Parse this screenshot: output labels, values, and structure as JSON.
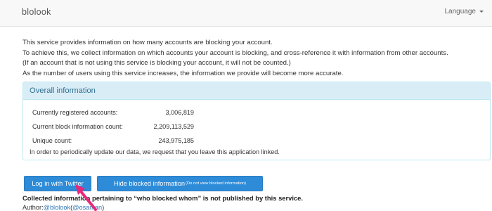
{
  "navbar": {
    "brand": "blolook",
    "language_label": "Language"
  },
  "intro": {
    "lines": [
      "This service provides information on how many accounts are blocking your account.",
      "To achieve this, we collect information on which accounts your account is blocking, and cross-reference it with information from other accounts.",
      "(If an account that is not using this service is blocking your account, it will not be counted.)",
      "As the number of users using this service increases, the information we provide will become more accurate."
    ]
  },
  "overall": {
    "heading": "Overall information",
    "stats": [
      {
        "label": "Currently registered accounts:",
        "value": "3,006,819"
      },
      {
        "label": "Current block information count:",
        "value": "2,209,113,529"
      },
      {
        "label": "Unique count:",
        "value": "243,975,185"
      }
    ],
    "note": "In order to periodically update our data, we request that you leave this application linked."
  },
  "buttons": {
    "login_label": "Log in with Twitter",
    "hide_label": "Hide blocked information",
    "hide_sub_label": "(Do not view blocked information)"
  },
  "footer": {
    "disclaimer": "Collected information pertaining to “who blocked whom” is not published by this service.",
    "author_prefix": "Author:",
    "author_link1": "@blolook",
    "author_paren_open": "(",
    "author_link2": "@osaman",
    "author_paren_close": ")"
  },
  "colors": {
    "button_bg": "#2e8bd8",
    "panel_heading_bg": "#d9edf7",
    "panel_heading_text": "#31708f",
    "annotation_arrow": "#e8287a"
  },
  "icons": {
    "language_caret": "caret-down-icon",
    "annotation": "pointer-arrow-icon"
  }
}
